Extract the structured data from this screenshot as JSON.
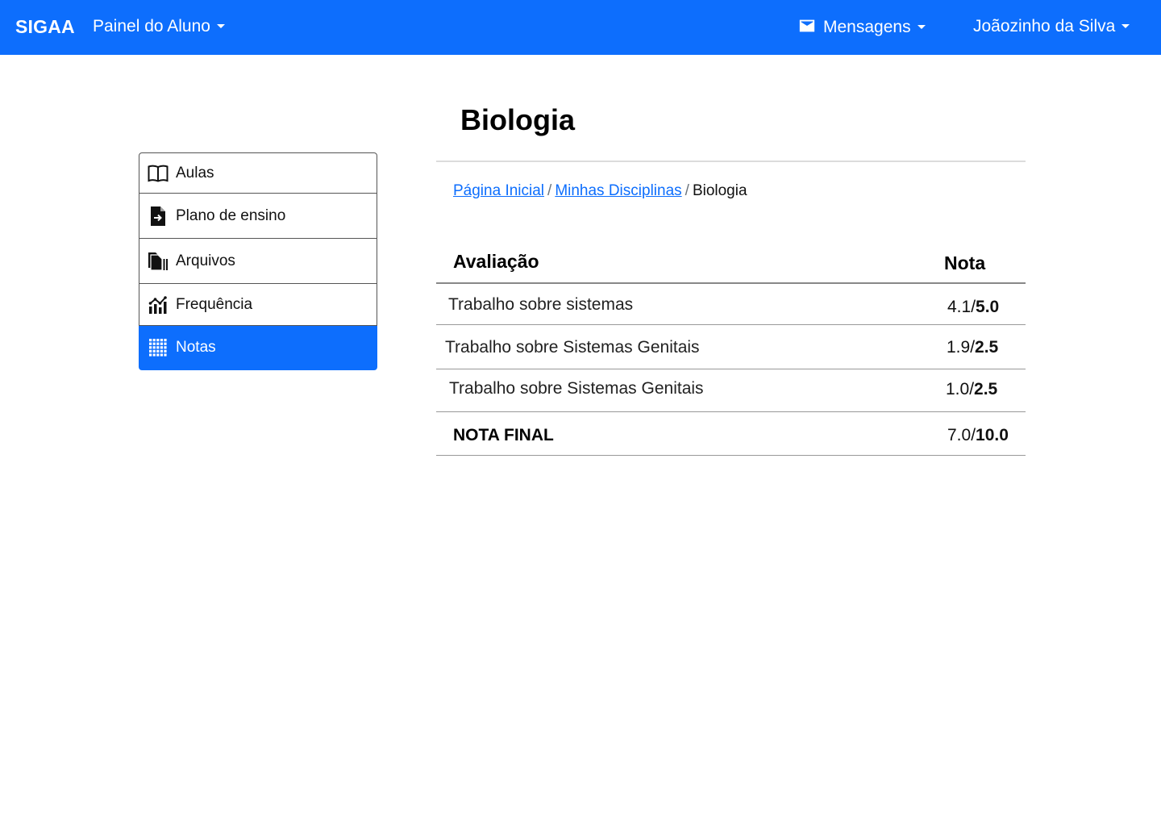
{
  "navbar": {
    "brand": "SIGAA",
    "panel_label": "Painel do Aluno",
    "messages_label": "Mensagens",
    "user_label": "Joãozinho da Silva",
    "bg_color": "#0d6efd"
  },
  "sidebar": {
    "items": [
      {
        "label": "Aulas",
        "icon": "book-open-icon",
        "active": false
      },
      {
        "label": "Plano de ensino",
        "icon": "file-arrow-icon",
        "active": false
      },
      {
        "label": "Arquivos",
        "icon": "files-icon",
        "active": false
      },
      {
        "label": "Frequência",
        "icon": "bar-chart-icon",
        "active": false
      },
      {
        "label": "Notas",
        "icon": "grid-icon",
        "active": true
      }
    ]
  },
  "main": {
    "title": "Biologia",
    "breadcrumb": {
      "home": "Página Inicial",
      "disciplines": "Minhas Disciplinas",
      "current": "Biologia",
      "separator": "/"
    },
    "grades": {
      "header_assessment": "Avaliação",
      "header_grade": "Nota",
      "rows": [
        {
          "name": "Trabalho sobre sistemas",
          "score": "4.1/",
          "max": "5.0"
        },
        {
          "name": "Trabalho sobre Sistemas Genitais",
          "score": "1.9/",
          "max": "2.5"
        },
        {
          "name": "Trabalho sobre Sistemas Genitais",
          "score": "1.0/",
          "max": "2.5"
        }
      ],
      "final": {
        "name": "NOTA FINAL",
        "score": "7.0/",
        "max": "10.0"
      }
    }
  }
}
